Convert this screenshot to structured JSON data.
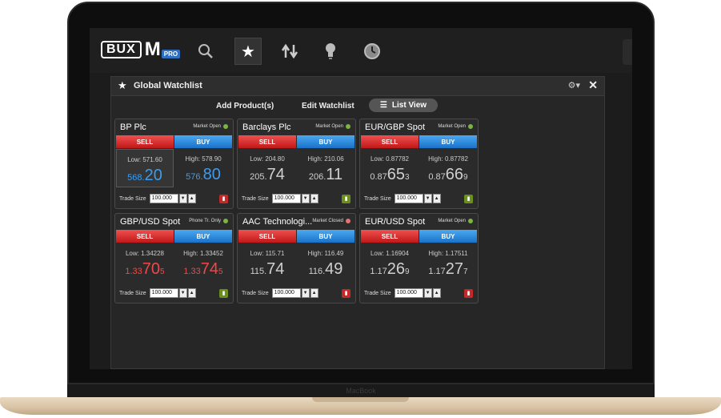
{
  "app": {
    "logo_main": "BUX",
    "logo_m": "M",
    "logo_badge": "PRO",
    "bezel_label": "MacBook"
  },
  "toolbar": {
    "icons": [
      "search-icon",
      "star-icon",
      "transfer-arrows-icon",
      "lightbulb-icon",
      "clock-icon"
    ],
    "active_icon": "star-icon"
  },
  "panel": {
    "title": "Global Watchlist",
    "add_products": "Add Product(s)",
    "edit_watchlist": "Edit Watchlist",
    "list_view": "List View"
  },
  "labels": {
    "sell": "SELL",
    "buy": "BUY",
    "trade_size": "Trade Size"
  },
  "colors": {
    "sell": "#d32f2f",
    "buy": "#1e88e5",
    "status_dot": "#7cb342",
    "status_dot_closed": "#e57373"
  },
  "cards": [
    {
      "name": "BP Plc",
      "status": "Market Open",
      "status_color": "#7cb342",
      "low": "Low: 571.60",
      "high": "High: 578.90",
      "sell_a": "568.",
      "sell_b": "20",
      "sell_c": "",
      "buy_a": "576.",
      "buy_b": "80",
      "buy_c": "",
      "price_color": "blue",
      "trade_size": "100.000",
      "lock": "red"
    },
    {
      "name": "Barclays Plc",
      "status": "Market Open",
      "status_color": "#7cb342",
      "low": "Low: 204.80",
      "high": "High: 210.06",
      "sell_a": "205.",
      "sell_b": "74",
      "sell_c": "",
      "buy_a": "206.",
      "buy_b": "11",
      "buy_c": "",
      "price_color": "grey",
      "trade_size": "100.000",
      "lock": "green"
    },
    {
      "name": "EUR/GBP Spot",
      "status": "Market Open",
      "status_color": "#7cb342",
      "low": "Low: 0.87782",
      "high": "High: 0.87782",
      "sell_a": "0.87",
      "sell_b": "65",
      "sell_c": "3",
      "buy_a": "0.87",
      "buy_b": "66",
      "buy_c": "9",
      "price_color": "grey",
      "trade_size": "100.000",
      "lock": "green"
    },
    {
      "name": "GBP/USD Spot",
      "status": "Phone Tr. Only",
      "status_color": "#7cb342",
      "low": "Low: 1.34228",
      "high": "High: 1.33452",
      "sell_a": "1.33",
      "sell_b": "70",
      "sell_c": "5",
      "buy_a": "1.33",
      "buy_b": "74",
      "buy_c": "5",
      "price_color": "red",
      "trade_size": "100.000",
      "lock": "green"
    },
    {
      "name": "AAC Technologi...",
      "status": "Market Closed",
      "status_color": "#e57373",
      "low": "Low: 115.71",
      "high": "High: 116.49",
      "sell_a": "115.",
      "sell_b": "74",
      "sell_c": "",
      "buy_a": "116.",
      "buy_b": "49",
      "buy_c": "",
      "price_color": "grey",
      "trade_size": "100.000",
      "lock": "red"
    },
    {
      "name": "EUR/USD Spot",
      "status": "Market Open",
      "status_color": "#7cb342",
      "low": "Low: 1.16904",
      "high": "High: 1.17511",
      "sell_a": "1.17",
      "sell_b": "26",
      "sell_c": "9",
      "buy_a": "1.17",
      "buy_b": "27",
      "buy_c": "7",
      "price_color": "grey",
      "trade_size": "100.000",
      "lock": "red"
    }
  ]
}
